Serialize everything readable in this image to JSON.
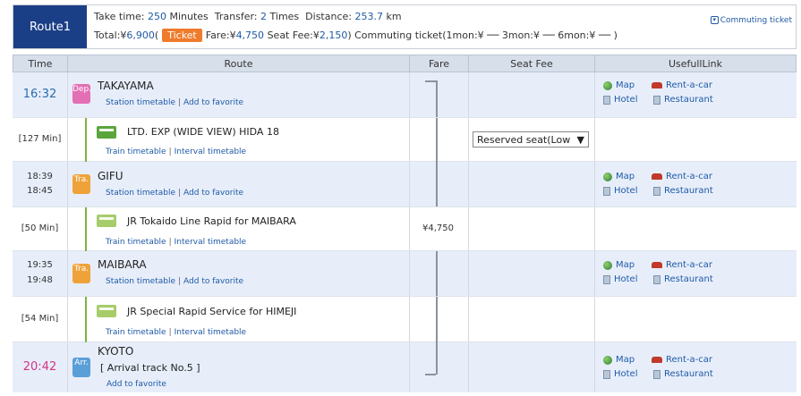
{
  "summary": {
    "route_label": "Route1",
    "take_time_label": "Take time:",
    "take_time_value": "250",
    "take_time_unit": "Minutes",
    "transfer_label": "Transfer:",
    "transfer_value": "2",
    "transfer_unit": "Times",
    "distance_label": "Distance:",
    "distance_value": "253.7",
    "distance_unit": "km",
    "total_label": "Total:¥",
    "total_value": "6,900",
    "paren_open": "(",
    "ticket_label": "Ticket",
    "fare_label": "Fare:¥",
    "fare_value": "4,750",
    "seat_fee_label": "Seat Fee:¥",
    "seat_fee_value": "2,150",
    "paren_close": ")",
    "commuting_text": "Commuting ticket(1mon:¥ ── 3mon:¥ ── 6mon:¥ ── )",
    "commuting_link": "Commuting ticket"
  },
  "headers": {
    "time": "Time",
    "route": "Route",
    "fare": "Fare",
    "seat_fee": "Seat Fee",
    "useful_link": "UsefullLink"
  },
  "links": {
    "station_timetable": "Station timetable",
    "add_favorite": "Add to favorite",
    "train_timetable": "Train timetable",
    "interval_timetable": "Interval timetable",
    "map": "Map",
    "rent_a_car": "Rent-a-car",
    "hotel": "Hotel",
    "restaurant": "Restaurant"
  },
  "stations": [
    {
      "time": "16:32",
      "badge": "Dep.",
      "name": "TAKAYAMA"
    },
    {
      "time_arr": "18:39",
      "time_dep": "18:45",
      "badge": "Tra.",
      "name": "GIFU"
    },
    {
      "time_arr": "19:35",
      "time_dep": "19:48",
      "badge": "Tra.",
      "name": "MAIBARA"
    },
    {
      "time": "20:42",
      "badge": "Arr.",
      "name": "KYOTO",
      "arrival_track": "[ Arrival track No.5 ]"
    }
  ],
  "segments": [
    {
      "duration": "[127 Min]",
      "train": "LTD. EXP (WIDE VIEW) HIDA 18",
      "seat_select": "Reserved seat(Low",
      "fare": ""
    },
    {
      "duration": "[50 Min]",
      "train": "JR Tokaido Line Rapid  for MAIBARA",
      "seat_select": "",
      "fare": "¥4,750"
    },
    {
      "duration": "[54 Min]",
      "train": "JR Special Rapid Service  for HIMEJI",
      "seat_select": "",
      "fare": ""
    }
  ],
  "colors": {
    "route_badge": "#1b3f86",
    "ticket_badge": "#ef7b2c",
    "header_bg": "#d7dfea",
    "station_bg": "#e7eefa",
    "link": "#1f5aa6",
    "dep_badge": "#e36fb4",
    "tra_badge": "#f0a23a",
    "arr_badge": "#5b9fd8"
  }
}
